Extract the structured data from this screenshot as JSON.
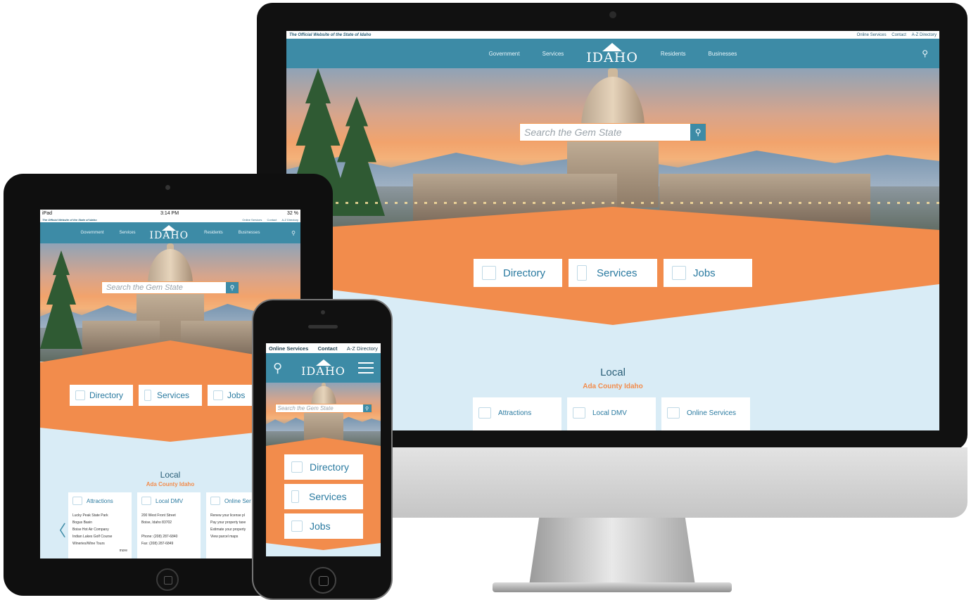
{
  "desktop": {
    "tagline": "The Official Website of the State of Idaho",
    "util_links": [
      "Online Services",
      "Contact",
      "A-Z Directory"
    ],
    "nav_left": [
      "Government",
      "Services"
    ],
    "nav_right": [
      "Residents",
      "Businesses"
    ],
    "logo": "IDAHO",
    "search_placeholder": "Search the Gem State",
    "cards": [
      "Directory",
      "Services",
      "Jobs"
    ],
    "local_title": "Local",
    "local_sub": "Ada County Idaho",
    "services": [
      "Attractions",
      "Local DMV",
      "Online Services"
    ]
  },
  "tablet": {
    "status_left": "iPad",
    "status_time": "3:14 PM",
    "status_right": "32 %",
    "tagline": "The Official Website of the State of Idaho",
    "util_links": [
      "Online Services",
      "Contact",
      "A-Z Directory"
    ],
    "nav_left": [
      "Government",
      "Services"
    ],
    "nav_right": [
      "Residents",
      "Businesses"
    ],
    "logo": "IDAHO",
    "search_placeholder": "Search the Gem State",
    "cards": [
      "Directory",
      "Services",
      "Jobs"
    ],
    "local_title": "Local",
    "local_sub": "Ada County Idaho",
    "services": [
      {
        "title": "Attractions",
        "lines": [
          "Lucky Peak State Park",
          "Bogus Basin",
          "Boise Hot Air Company",
          "Indian Lakes Golf Course",
          "Wineries/Wine Tours"
        ],
        "more": "more"
      },
      {
        "title": "Local DMV",
        "lines": [
          "200 West Front Street",
          "Boise, Idaho 83702",
          "",
          "Phone: (208) 287-6840",
          "Fax: (208) 287-6849"
        ]
      },
      {
        "title": "Online Ser",
        "lines": [
          "Renew your license pl",
          "Pay your property taxe",
          "Estimate your property",
          "View parcel maps"
        ]
      }
    ],
    "prev_arrow": "〈"
  },
  "phone": {
    "util_links": [
      "Online Services",
      "Contact",
      "A-Z Directory"
    ],
    "logo": "IDAHO",
    "search_placeholder": "Search the Gem State",
    "cards": [
      "Directory",
      "Services",
      "Jobs"
    ]
  },
  "colors": {
    "brand_blue": "#3d8ba6",
    "accent_orange": "#f28c4c",
    "light_blue": "#d9ecf6"
  }
}
